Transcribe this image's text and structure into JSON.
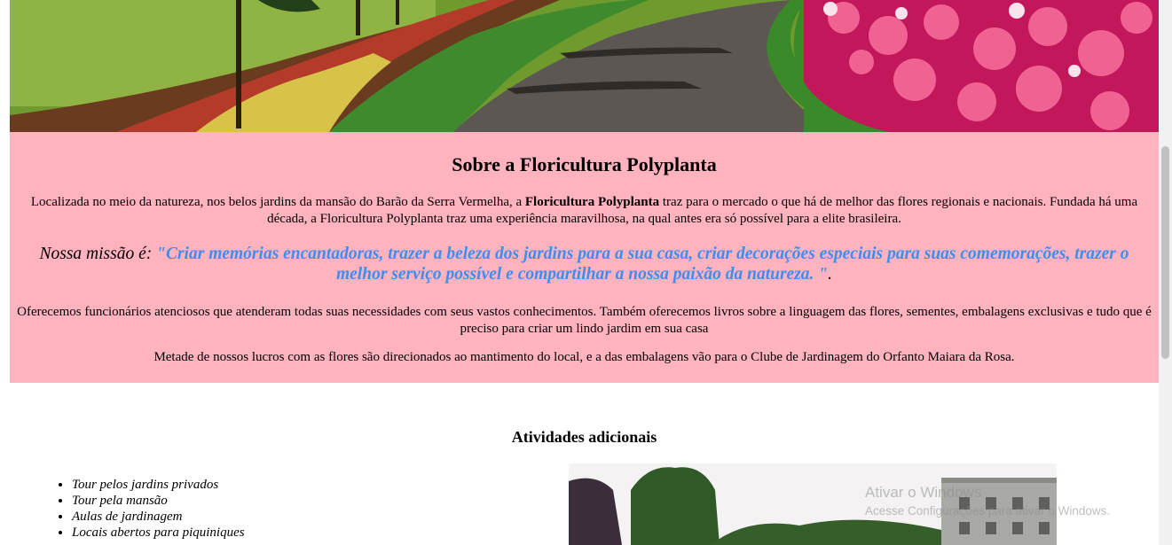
{
  "hero": {
    "image_name": "garden-path-photo"
  },
  "about": {
    "title": "Sobre a Floricultura Polyplanta",
    "intro_before": "Localizada no meio da natureza, nos belos jardins da mansão do Barão da Serra Vermelha, a ",
    "intro_bold": "Floricultura Polyplanta",
    "intro_after": " traz para o mercado o que há de melhor das flores regionais e nacionais. Fundada há uma década, a Floricultura Polyplanta traz uma experiência maravilhosa, na qual antes era só possível para a elite brasileira.",
    "mission_label": "Nossa missão é: ",
    "mission_quote": "\"Criar memórias encantadoras, trazer a beleza dos jardins para a sua casa, criar decorações especiais para suas comemorações, trazer o melhor serviço possível e compartilhar a nossa paixão da natureza. \"",
    "mission_end": ".",
    "services": "Oferecemos funcionários atenciosos que atenderam todas suas necessidades com seus vastos conhecimentos. Também oferecemos livros sobre a linguagem das flores, sementes, embalagens exclusivas e tudo que é preciso para criar um lindo jardim em sua casa",
    "profits": "Metade de nossos lucros com as flores são direcionados ao mantimento do local, e a das embalagens vão para o Clube de Jardinagem do Orfanto Maiara da Rosa.",
    "background_color": "#ffb3bf",
    "quote_color": "#3d8ef0"
  },
  "activities": {
    "title": "Atividades adicionais",
    "items": [
      "Tour pelos jardins privados",
      "Tour pela mansão",
      "Aulas de jardinagem",
      "Locais abertos para piquiniques"
    ]
  },
  "watermark": {
    "line1": "Ativar o Windows",
    "line2": "Acesse Configurações para ativar o Windows."
  }
}
